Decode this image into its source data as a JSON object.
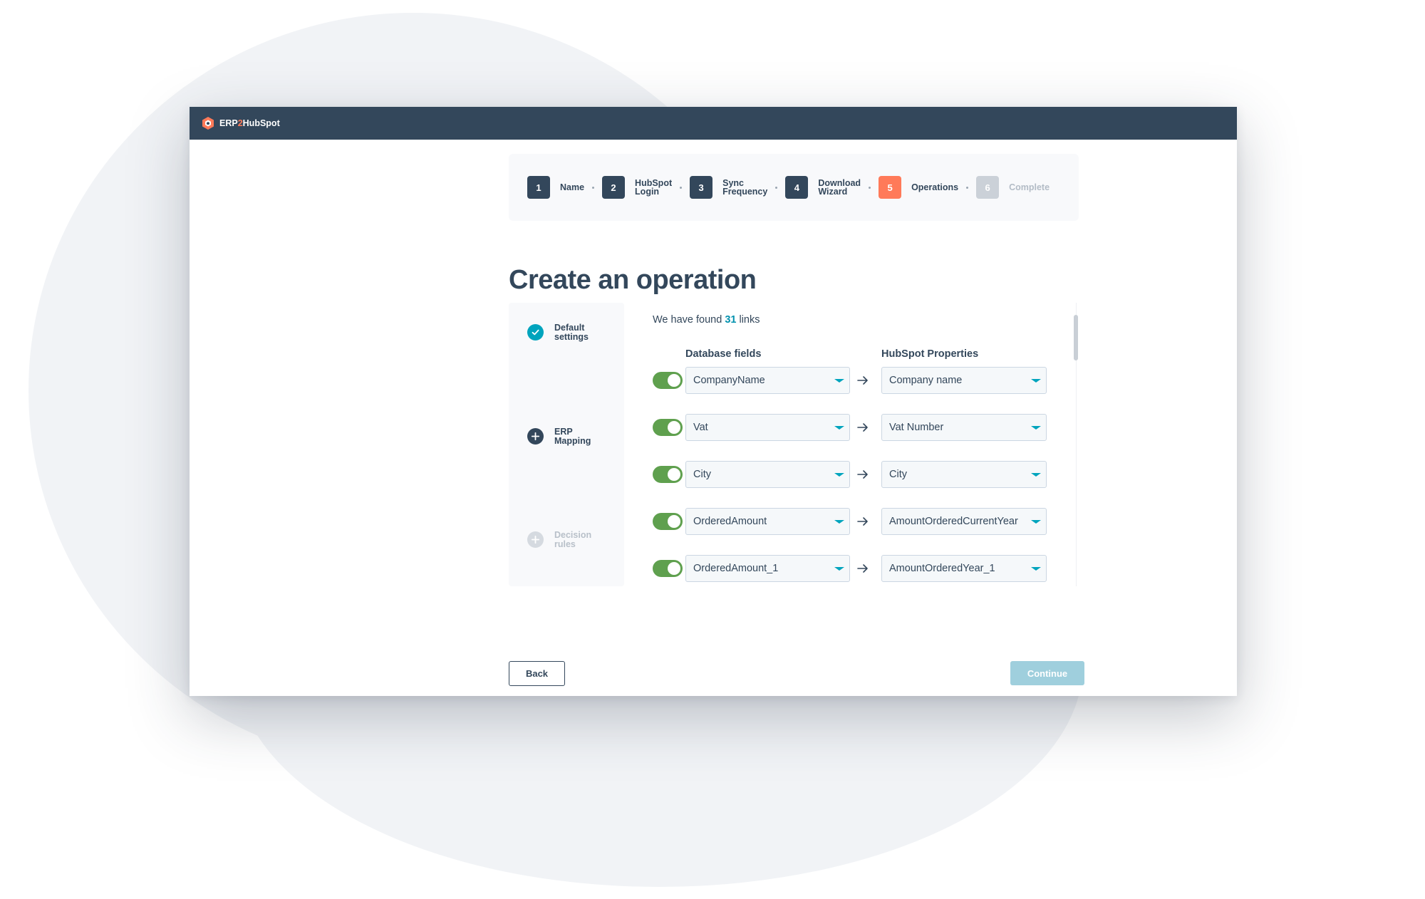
{
  "app": {
    "brand_prefix": "ERP",
    "brand_two": "2",
    "brand_suffix": "HubSpot"
  },
  "stepper": [
    {
      "num": "1",
      "line1": "Name",
      "line2": "",
      "state": "done"
    },
    {
      "num": "2",
      "line1": "HubSpot",
      "line2": "Login",
      "state": "done"
    },
    {
      "num": "3",
      "line1": "Sync",
      "line2": "Frequency",
      "state": "done"
    },
    {
      "num": "4",
      "line1": "Download",
      "line2": "Wizard",
      "state": "done"
    },
    {
      "num": "5",
      "line1": "Operations",
      "line2": "",
      "state": "active"
    },
    {
      "num": "6",
      "line1": "Complete",
      "line2": "",
      "state": "disabled"
    }
  ],
  "page": {
    "title": "Create an operation"
  },
  "sections": [
    {
      "line1": "Default",
      "line2": "settings",
      "icon": "check-circle-icon",
      "state": "done"
    },
    {
      "line1": "ERP",
      "line2": "Mapping",
      "icon": "plus-circle-icon",
      "state": "current"
    },
    {
      "line1": "Decision",
      "line2": "rules",
      "icon": "plus-circle-icon",
      "state": "disabled"
    }
  ],
  "mapping": {
    "found_prefix": "We have found",
    "found_count": "31",
    "found_suffix": "links",
    "col_db": "Database fields",
    "col_hs": "HubSpot Properties",
    "rows": [
      {
        "db": "CompanyName",
        "hs": "Company name",
        "enabled": true
      },
      {
        "db": "Vat",
        "hs": "Vat Number",
        "enabled": true
      },
      {
        "db": "City",
        "hs": "City",
        "enabled": true
      },
      {
        "db": "OrderedAmount",
        "hs": "AmountOrderedCurrentYear",
        "enabled": true
      },
      {
        "db": "OrderedAmount_1",
        "hs": "AmountOrderedYear_1",
        "enabled": true
      }
    ]
  },
  "buttons": {
    "back": "Back",
    "continue": "Continue"
  },
  "colors": {
    "navy": "#33475b",
    "accent_orange": "#ff7a59",
    "teal": "#00a4bd",
    "toggle_green": "#5fa04e",
    "continue_disabled": "#9fcfdd"
  }
}
